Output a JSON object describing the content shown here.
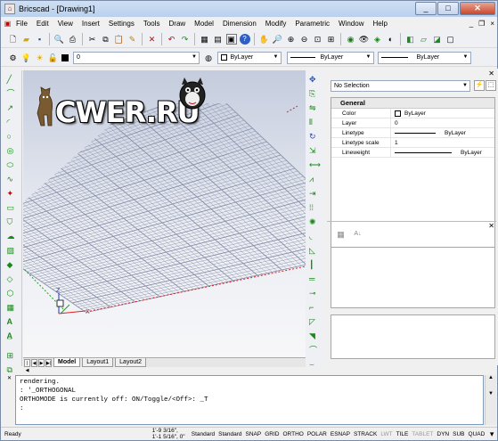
{
  "app": {
    "title": "Bricscad - [Drawing1]",
    "icon": "bricscad-icon"
  },
  "window": {
    "min": "_",
    "max": "□",
    "close": "✕"
  },
  "menu": [
    "File",
    "Edit",
    "View",
    "Insert",
    "Settings",
    "Tools",
    "Draw",
    "Model",
    "Dimension",
    "Modify",
    "Parametric",
    "Window",
    "Help"
  ],
  "mdi": {
    "min": "_",
    "restore": "❐",
    "close": "×"
  },
  "layer": {
    "current": "0",
    "color": "ByLayer",
    "linetype": "ByLayer",
    "lineweight": "ByLayer"
  },
  "properties": {
    "selection": "No Selection",
    "section": "General",
    "rows": [
      {
        "key": "Color",
        "value": "ByLayer",
        "swatch": "#ffffff"
      },
      {
        "key": "Layer",
        "value": "0"
      },
      {
        "key": "Linetype",
        "value": "ByLayer",
        "line": true
      },
      {
        "key": "Linetype scale",
        "value": "1"
      },
      {
        "key": "Lineweight",
        "value": "ByLayer",
        "line": true
      }
    ]
  },
  "tabs": {
    "model": "Model",
    "layout1": "Layout1",
    "layout2": "Layout2"
  },
  "ucs": {
    "z": "Z",
    "x": "X"
  },
  "watermark": "CWER.RU",
  "command": {
    "lines": [
      "rendering.",
      ": '_ORTHOGONAL",
      "ORTHOMODE is currently off:  ON/Toggle/<Off>: _T",
      ":"
    ]
  },
  "status": {
    "ready": "Ready",
    "coords": "1'-9 3/16\", 1'-1 5/16\", 0\"",
    "textstyle": "Standard",
    "dimstyle": "Standard",
    "toggles": [
      "SNAP",
      "GRID",
      "ORTHO",
      "POLAR",
      "ESNAP",
      "STRACK",
      "LWT",
      "TILE",
      "TABLET",
      "DYN",
      "SUB",
      "QUAD"
    ],
    "toggles_dim": [
      "LWT",
      "TABLET"
    ]
  },
  "colors": {
    "accent_red": "#cc0000",
    "axis_green": "#1aa31a",
    "axis_blue": "#2233cc",
    "grid": "#8891aa"
  }
}
